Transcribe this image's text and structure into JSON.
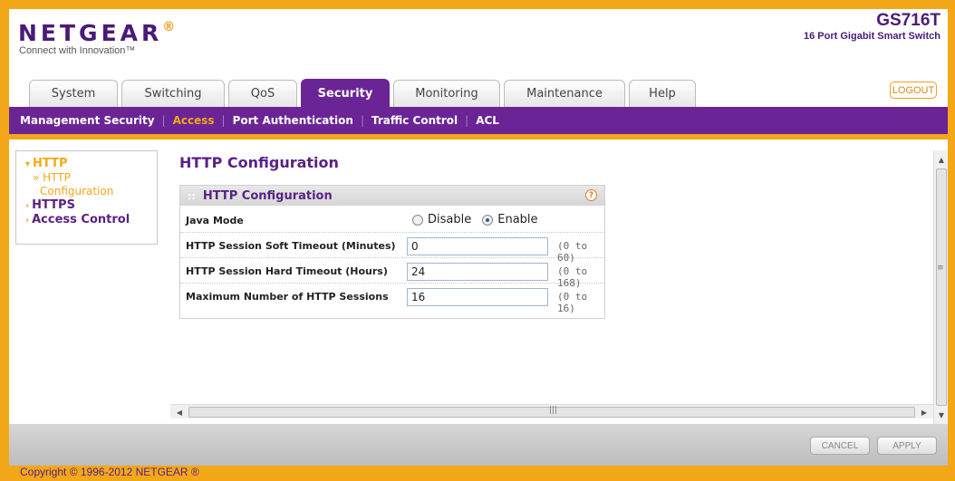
{
  "header": {
    "brand": "NETGEAR",
    "brand_mark": "®",
    "tagline": "Connect with Innovation™",
    "model": "GS716T",
    "model_subtitle": "16 Port Gigabit Smart Switch"
  },
  "tabs": [
    {
      "label": "System"
    },
    {
      "label": "Switching"
    },
    {
      "label": "QoS"
    },
    {
      "label": "Security"
    },
    {
      "label": "Monitoring"
    },
    {
      "label": "Maintenance"
    },
    {
      "label": "Help"
    }
  ],
  "logout_label": "LOGOUT",
  "subnav": [
    {
      "label": "Management Security"
    },
    {
      "label": "Access"
    },
    {
      "label": "Port Authentication"
    },
    {
      "label": "Traffic Control"
    },
    {
      "label": "ACL"
    }
  ],
  "leftmenu": {
    "http": "HTTP",
    "http_config_line1": "» HTTP",
    "http_config_line2": "Configuration",
    "https": "HTTPS",
    "access_control": "Access Control"
  },
  "page_title": "HTTP Configuration",
  "box": {
    "title": "HTTP Configuration",
    "help_icon": "?",
    "java_mode_label": "Java Mode",
    "java_options": [
      "Disable",
      "Enable"
    ],
    "java_selected": "Enable",
    "soft_timeout_label": "HTTP Session Soft Timeout (Minutes)",
    "soft_timeout_value": "0",
    "soft_timeout_range": "(0 to 60)",
    "hard_timeout_label": "HTTP Session Hard Timeout (Hours)",
    "hard_timeout_value": "24",
    "hard_timeout_range": "(0 to 168)",
    "max_sessions_label": "Maximum Number of HTTP Sessions",
    "max_sessions_value": "16",
    "max_sessions_range": "(0 to 16)"
  },
  "footer": {
    "cancel": "CANCEL",
    "apply": "APPLY",
    "copyright": "Copyright © 1996-2012 NETGEAR ®"
  },
  "colors": {
    "orange": "#f3a819",
    "purple": "#6b2496"
  }
}
